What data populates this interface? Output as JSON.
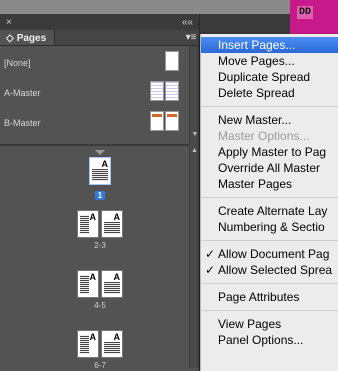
{
  "panel": {
    "close_glyph": "×",
    "collapse_glyph": "««",
    "tab_label": "Pages",
    "tab_icon": "◇",
    "menu_glyph": "▾≡"
  },
  "masters": [
    {
      "label": "[None]",
      "thumb": "blank"
    },
    {
      "label": "A-Master",
      "thumb": "dotted"
    },
    {
      "label": "B-Master",
      "thumb": "orange"
    }
  ],
  "pages": [
    {
      "label": "1",
      "selected": true,
      "single": true
    },
    {
      "label": "2-3",
      "selected": false
    },
    {
      "label": "4-5",
      "selected": false
    },
    {
      "label": "6-7",
      "selected": false
    }
  ],
  "page_letter": "A",
  "menu": {
    "items": [
      {
        "label": "Insert Pages...",
        "state": "highlighted"
      },
      {
        "label": "Move Pages...",
        "state": "normal"
      },
      {
        "label": "Duplicate Spread",
        "state": "normal"
      },
      {
        "label": "Delete Spread",
        "state": "normal"
      },
      {
        "sep": true
      },
      {
        "label": "New Master...",
        "state": "normal"
      },
      {
        "label": "Master Options...",
        "state": "disabled"
      },
      {
        "label": "Apply Master to Pag",
        "state": "normal"
      },
      {
        "label": "Override All Master",
        "state": "normal"
      },
      {
        "label": "Master Pages",
        "state": "normal"
      },
      {
        "sep": true
      },
      {
        "label": "Create Alternate Lay",
        "state": "normal"
      },
      {
        "label": "Numbering & Sectio",
        "state": "normal"
      },
      {
        "sep": true
      },
      {
        "label": "Allow Document Pag",
        "state": "normal",
        "checked": true
      },
      {
        "label": "Allow Selected Sprea",
        "state": "normal",
        "checked": true
      },
      {
        "sep": true
      },
      {
        "label": "Page Attributes",
        "state": "normal"
      },
      {
        "sep": true
      },
      {
        "label": "View Pages",
        "state": "normal"
      },
      {
        "label": "Panel Options...",
        "state": "normal"
      }
    ],
    "check_glyph": "✓"
  },
  "background": {
    "glyph": "DD"
  },
  "colors": {
    "highlight": "#2a68d8",
    "selected_page": "#2f7bdc",
    "b_master_bar": "#d06a2a",
    "doc_accent": "#c8198a"
  }
}
